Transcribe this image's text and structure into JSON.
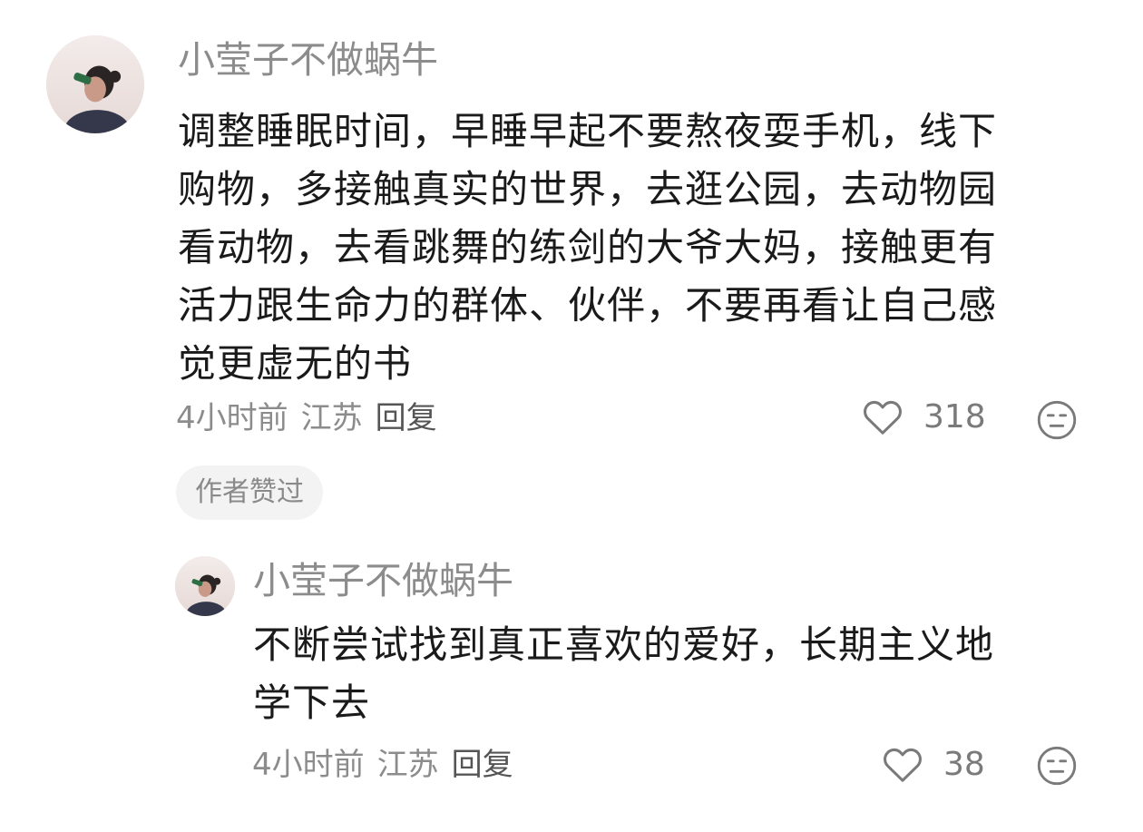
{
  "comment": {
    "username": "小莹子不做蜗牛",
    "avatar_icon": "user-avatar-icon",
    "lines": [
      "调整睡眠时间，早睡早起不要熬夜耍手机，线下",
      "购物，多接触真实的世界，去逛公园，去动物园",
      "看动物，去看跳舞的练剑的大爷大妈，接触更有",
      "活力跟生命力的群体、伙伴，不要再看让自己感",
      "觉更虚无的书"
    ],
    "time": "4小时前",
    "location": "江苏",
    "reply_label": "回复",
    "like_count": "318",
    "badge": "作者赞过"
  },
  "reply": {
    "username": "小莹子不做蜗牛",
    "avatar_icon": "user-avatar-icon",
    "lines": [
      "不断尝试找到真正喜欢的爱好，长期主义地",
      "学下去"
    ],
    "time": "4小时前",
    "location": "江苏",
    "reply_label": "回复",
    "like_count": "38"
  },
  "colors": {
    "text_primary": "#1a1a1a",
    "text_secondary": "#8c8c8c",
    "badge_bg": "#f3f3f3"
  }
}
